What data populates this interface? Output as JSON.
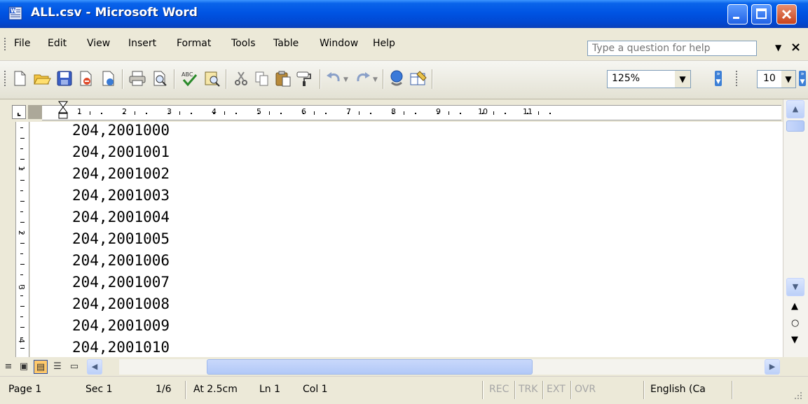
{
  "window": {
    "title": "ALL.csv - Microsoft Word"
  },
  "menu": {
    "items": [
      "File",
      "Edit",
      "View",
      "Insert",
      "Format",
      "Tools",
      "Table",
      "Window",
      "Help"
    ],
    "help_placeholder": "Type a question for help"
  },
  "toolbar": {
    "zoom": "125%",
    "font_size": "10",
    "icons": [
      "new-document-icon",
      "open-folder-icon",
      "save-icon",
      "permission-icon",
      "print-icon",
      "print-preview-icon",
      "spelling-icon",
      "research-icon",
      "cut-icon",
      "copy-icon",
      "paste-icon",
      "format-painter-icon",
      "undo-icon",
      "redo-icon",
      "insert-hyperlink-icon",
      "tables-borders-icon"
    ]
  },
  "ruler": {
    "labels": [
      "1",
      "2",
      "3",
      "4",
      "5",
      "6",
      "7",
      "8",
      "9",
      "10",
      "11"
    ]
  },
  "vertical_ruler": {
    "labels": [
      "1",
      "2",
      "3",
      "4"
    ]
  },
  "document": {
    "lines": [
      "204,2001000",
      "204,2001001",
      "204,2001002",
      "204,2001003",
      "204,2001004",
      "204,2001005",
      "204,2001006",
      "204,2001007",
      "204,2001008",
      "204,2001009",
      "204,2001010"
    ]
  },
  "status": {
    "page": "Page 1",
    "sec": "Sec 1",
    "pages": "1/6",
    "at": "At 2.5cm",
    "ln": "Ln 1",
    "col": "Col 1",
    "rec": "REC",
    "trk": "TRK",
    "ext": "EXT",
    "ovr": "OVR",
    "language": "English (Ca"
  }
}
